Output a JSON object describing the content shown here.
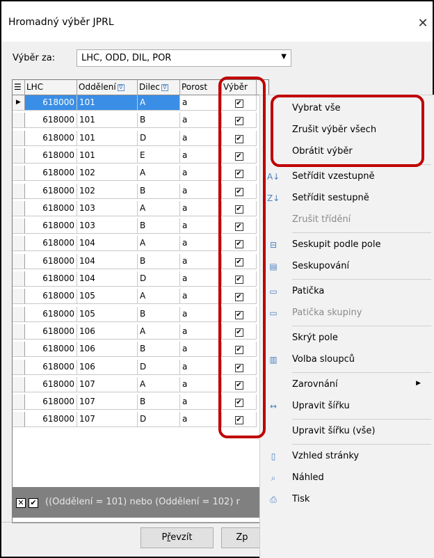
{
  "window": {
    "title": "Hromadný výběr JPRL",
    "close_glyph": "✕"
  },
  "filter": {
    "label": "Výběr za:",
    "value": "LHC, ODD, DIL, POR"
  },
  "grid": {
    "columns": [
      "LHC",
      "Oddělení",
      "Dilec",
      "Porost",
      "Výběr"
    ],
    "filter_glyph": "∇",
    "rows": [
      [
        "618000",
        "101",
        "A",
        "a",
        true
      ],
      [
        "618000",
        "101",
        "B",
        "a",
        true
      ],
      [
        "618000",
        "101",
        "D",
        "a",
        true
      ],
      [
        "618000",
        "101",
        "E",
        "a",
        true
      ],
      [
        "618000",
        "102",
        "A",
        "a",
        true
      ],
      [
        "618000",
        "102",
        "B",
        "a",
        true
      ],
      [
        "618000",
        "103",
        "A",
        "a",
        true
      ],
      [
        "618000",
        "103",
        "B",
        "a",
        true
      ],
      [
        "618000",
        "104",
        "A",
        "a",
        true
      ],
      [
        "618000",
        "104",
        "B",
        "a",
        true
      ],
      [
        "618000",
        "104",
        "D",
        "a",
        true
      ],
      [
        "618000",
        "105",
        "A",
        "a",
        true
      ],
      [
        "618000",
        "105",
        "B",
        "a",
        true
      ],
      [
        "618000",
        "106",
        "A",
        "a",
        true
      ],
      [
        "618000",
        "106",
        "B",
        "a",
        true
      ],
      [
        "618000",
        "106",
        "D",
        "a",
        true
      ],
      [
        "618000",
        "107",
        "A",
        "a",
        true
      ],
      [
        "618000",
        "107",
        "B",
        "a",
        true
      ],
      [
        "618000",
        "107",
        "D",
        "a",
        true
      ]
    ],
    "selected_row": 0
  },
  "status_bar": {
    "filter_text": "((Oddělení = 101) nebo (Oddělení = 102) r"
  },
  "buttons": {
    "accept_label": "Převzít",
    "accept_underline": "ř",
    "cancel_label_partial": "Zp"
  },
  "context_menu": {
    "items": [
      {
        "label": "Vybrat vše",
        "icon": "",
        "disabled": false
      },
      {
        "label": "Zrušit výběr všech",
        "icon": "",
        "disabled": false
      },
      {
        "label": "Obrátit výběr",
        "icon": "",
        "disabled": false
      },
      {
        "label": "Setřídit vzestupně",
        "icon": "sort-ascending-icon",
        "disabled": false,
        "sep_before": true
      },
      {
        "label": "Setřídit sestupně",
        "icon": "sort-descending-icon",
        "disabled": false
      },
      {
        "label": "Zrušit třídění",
        "icon": "",
        "disabled": true
      },
      {
        "label": "Seskupit podle pole",
        "icon": "group-by-field-icon",
        "disabled": false,
        "sep_before": true
      },
      {
        "label": "Seskupování",
        "icon": "grouping-icon",
        "disabled": false
      },
      {
        "label": "Patička",
        "icon": "footer-icon",
        "disabled": false,
        "sep_before": true
      },
      {
        "label": "Patička skupiny",
        "icon": "group-footer-icon",
        "disabled": true
      },
      {
        "label": "Skrýt pole",
        "icon": "",
        "disabled": false,
        "sep_before": true
      },
      {
        "label": "Volba sloupců",
        "icon": "column-chooser-icon",
        "disabled": false
      },
      {
        "label": "Zarovnání",
        "icon": "",
        "disabled": false,
        "sep_before": true,
        "submenu": true
      },
      {
        "label": "Upravit šířku",
        "icon": "best-fit-icon",
        "disabled": false
      },
      {
        "label": "Upravit šířku (vše)",
        "icon": "",
        "disabled": false,
        "sep_before": true
      },
      {
        "label": "Vzhled stránky",
        "icon": "page-setup-icon",
        "disabled": false,
        "sep_before": true
      },
      {
        "label": "Náhled",
        "icon": "print-preview-icon",
        "disabled": false
      },
      {
        "label": "Tisk",
        "icon": "print-icon",
        "disabled": false
      }
    ]
  },
  "colors": {
    "selection": "#3a8ee6",
    "highlight": "#c00000"
  }
}
